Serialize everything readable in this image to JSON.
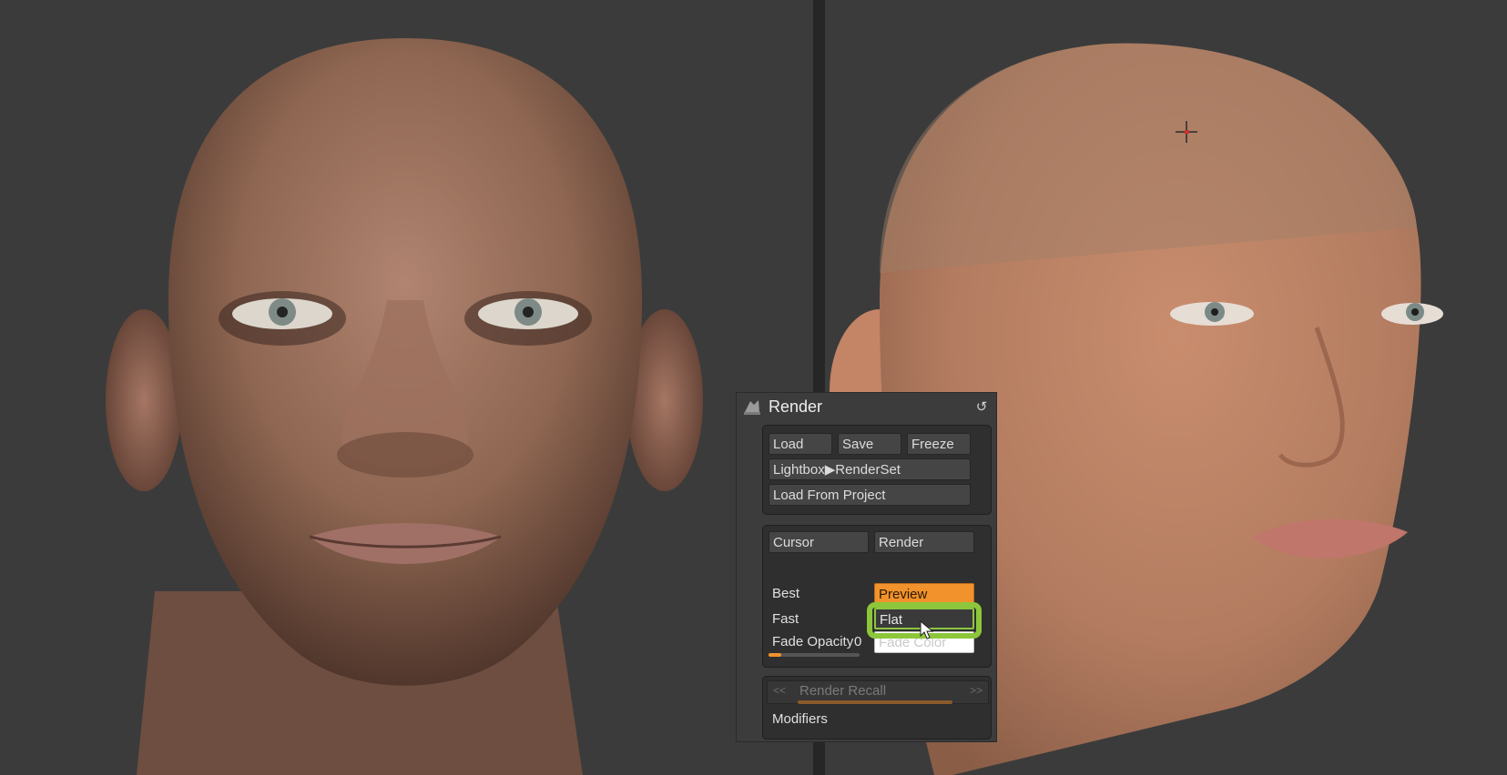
{
  "panel": {
    "title": "Render",
    "icon": "render-palette-icon",
    "reset_icon": "reset-icon"
  },
  "file_group": {
    "load": "Load",
    "save": "Save",
    "freeze": "Freeze",
    "lightbox": "Lightbox▶RenderSet",
    "load_from_project": "Load From Project"
  },
  "render_group": {
    "cursor": "Cursor",
    "render": "Render",
    "best": "Best",
    "preview": "Preview",
    "fast": "Fast",
    "flat": "Flat",
    "fade_opacity_label": "Fade Opacity",
    "fade_opacity_value": "0",
    "fade_opacity_level": 0.0,
    "fade_color": "Fade Color"
  },
  "recall_group": {
    "prev": "<<",
    "label": "Render Recall",
    "next": ">>",
    "modifiers": "Modifiers"
  },
  "colors": {
    "accent_orange": "#f2922c",
    "highlight_green": "#8dc63a",
    "panel_bg": "#3c3c3c",
    "viewport_bg": "#3b3b3b"
  }
}
